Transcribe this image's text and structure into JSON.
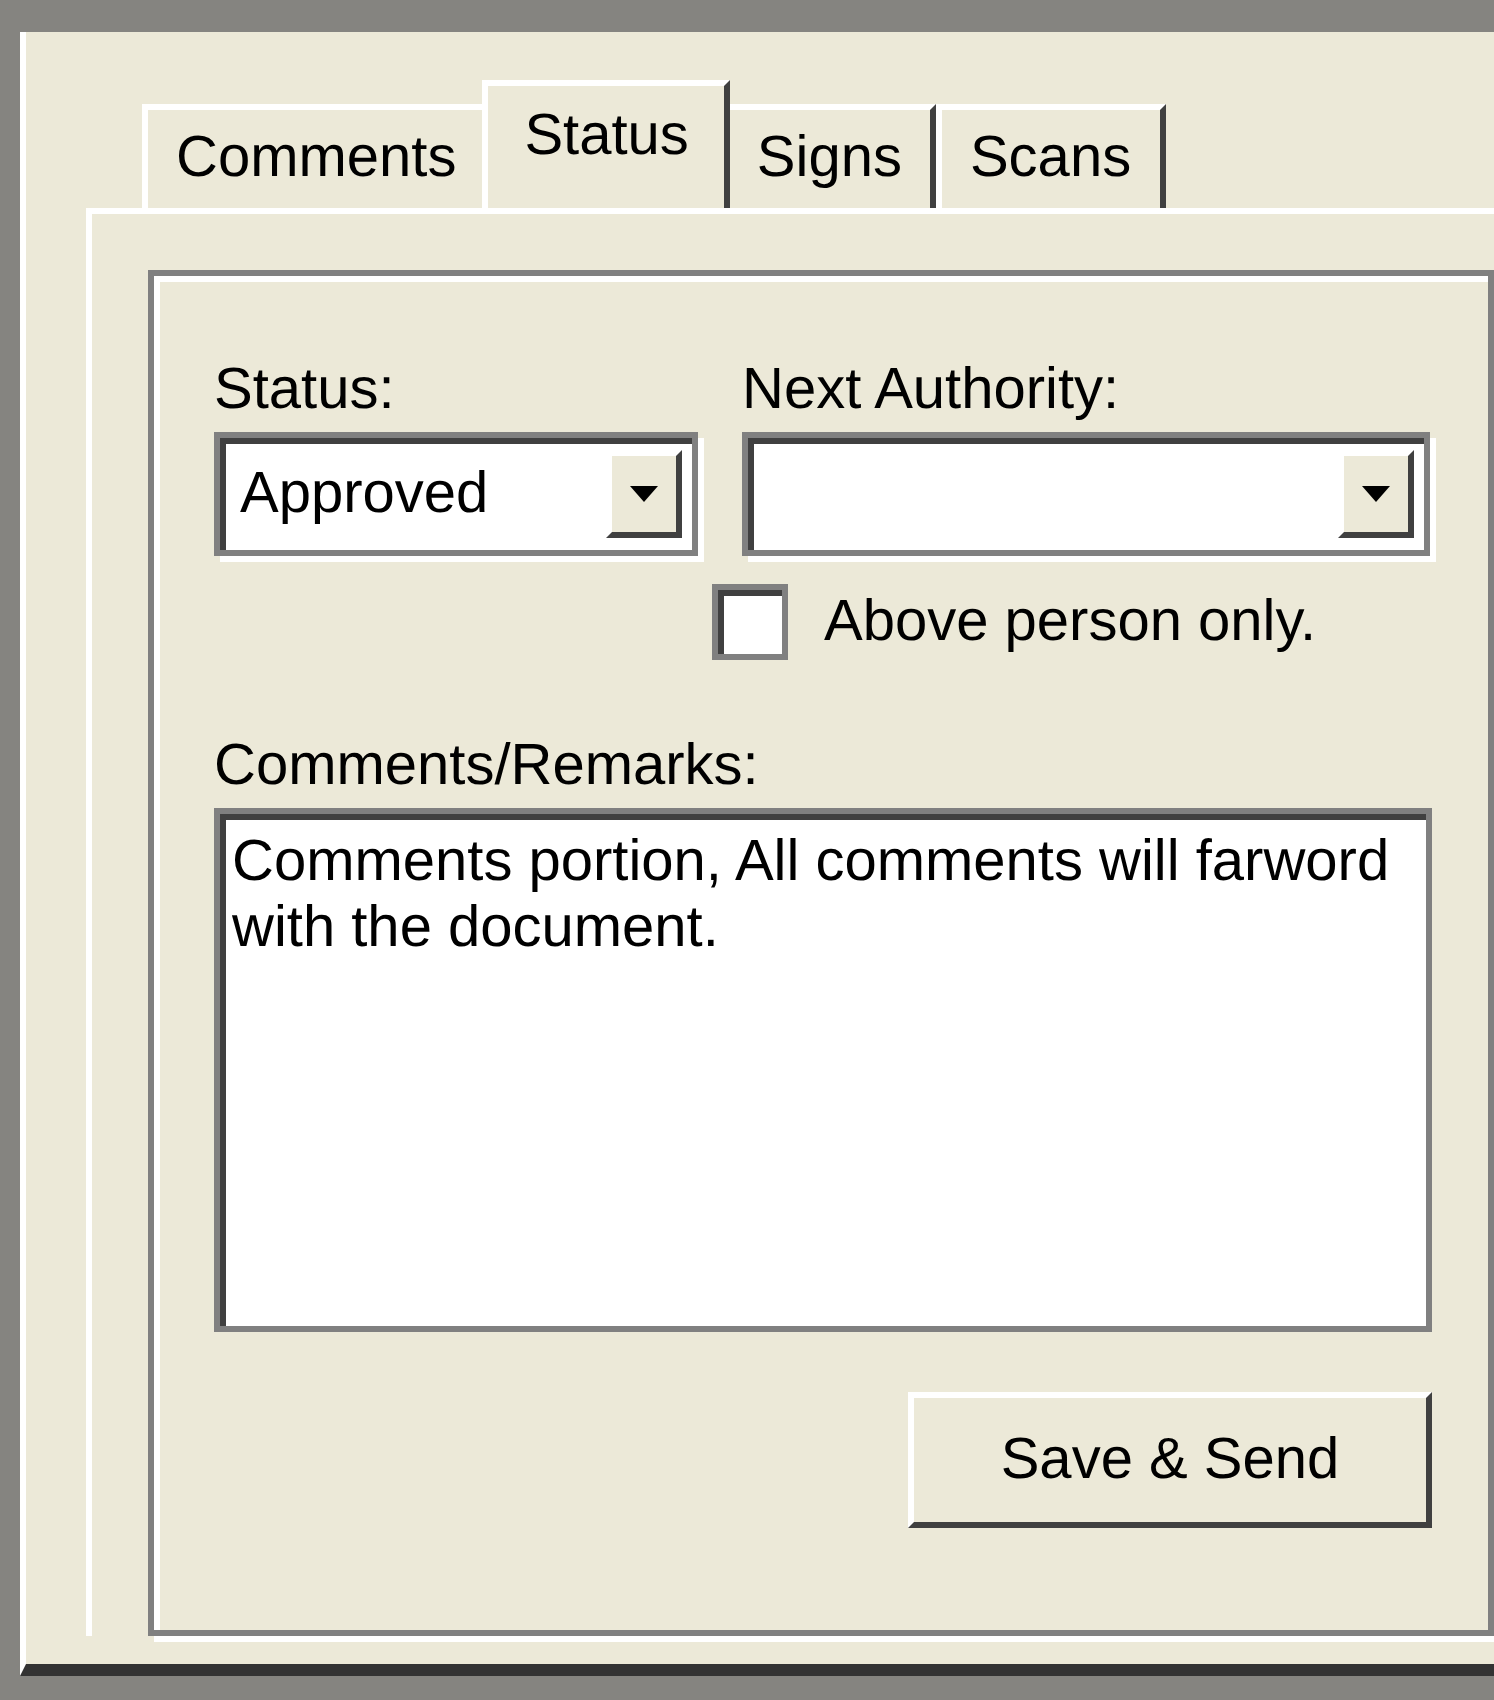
{
  "tabs": [
    {
      "label": "Comments",
      "selected": false
    },
    {
      "label": "Status",
      "selected": true
    },
    {
      "label": "Signs",
      "selected": false
    },
    {
      "label": "Scans",
      "selected": false
    }
  ],
  "status_label": "Status:",
  "status_combo": {
    "value": "Approved"
  },
  "next_authority_label": "Next Authority:",
  "above_person_checkbox": {
    "label": "Above person only.",
    "checked": false
  },
  "remarks_label": "Comments/Remarks:",
  "remarks_field": {
    "value": "Comments portion, All comments will farword with the document."
  },
  "save_button": {
    "label": "Save & Send"
  }
}
